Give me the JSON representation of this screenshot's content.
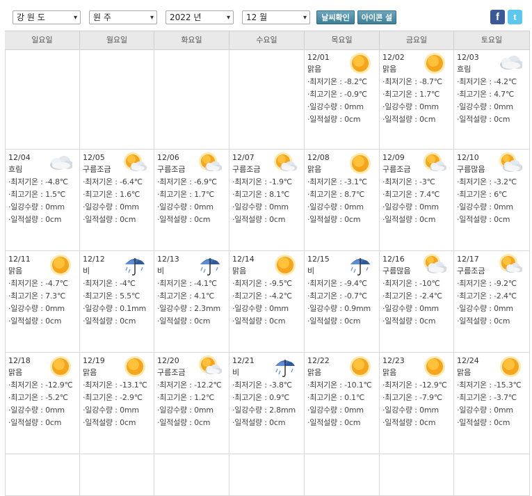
{
  "toolbar": {
    "province": "강 원 도",
    "city": "원 주",
    "year": "2022 년",
    "month": "12 월",
    "check_weather": "날씨확인",
    "icon_help": "아이콘 설명",
    "facebook": "f",
    "twitter": "t"
  },
  "weekdays": [
    "일요일",
    "월요일",
    "화요일",
    "수요일",
    "목요일",
    "금요일",
    "토요일"
  ],
  "labels": {
    "min": "·최저기온 : ",
    "max": "·최고기온 : ",
    "rain": "·일강수량 : ",
    "snow": "·일적설량 : "
  },
  "days": [
    {
      "date": "12/01",
      "cond": "맑음",
      "icon": "sun-icon",
      "min": "-8.2℃",
      "max": "-0.9℃",
      "rain": "0mm",
      "snow": "0cm"
    },
    {
      "date": "12/02",
      "cond": "맑음",
      "icon": "sun-icon",
      "min": "-8.7℃",
      "max": "1.7℃",
      "rain": "0mm",
      "snow": "0cm"
    },
    {
      "date": "12/03",
      "cond": "흐림",
      "icon": "cloud-icon",
      "min": "-4.2℃",
      "max": "4.7℃",
      "rain": "0mm",
      "snow": "0cm"
    },
    {
      "date": "12/04",
      "cond": "흐림",
      "icon": "cloud-icon",
      "min": "-4.8℃",
      "max": "1.5℃",
      "rain": "0mm",
      "snow": "0cm"
    },
    {
      "date": "12/05",
      "cond": "구름조금",
      "icon": "sun-cloud-icon",
      "min": "-6.4℃",
      "max": "1.6℃",
      "rain": "0mm",
      "snow": "0cm"
    },
    {
      "date": "12/06",
      "cond": "구름조금",
      "icon": "sun-cloud-icon",
      "min": "-6.9℃",
      "max": "1.7℃",
      "rain": "0mm",
      "snow": "0cm"
    },
    {
      "date": "12/07",
      "cond": "구름조금",
      "icon": "sun-cloud-icon",
      "min": "-1.9℃",
      "max": "8.1℃",
      "rain": "0mm",
      "snow": "0cm"
    },
    {
      "date": "12/08",
      "cond": "맑음",
      "icon": "sun-icon",
      "min": "-3.1℃",
      "max": "8.7℃",
      "rain": "0mm",
      "snow": "0cm"
    },
    {
      "date": "12/09",
      "cond": "구름조금",
      "icon": "sun-cloud-icon",
      "min": "-3℃",
      "max": "7.4℃",
      "rain": "0mm",
      "snow": "0cm"
    },
    {
      "date": "12/10",
      "cond": "구름많음",
      "icon": "cloud-sun-icon",
      "min": "-3.2℃",
      "max": "6℃",
      "rain": "0mm",
      "snow": "0cm"
    },
    {
      "date": "12/11",
      "cond": "맑음",
      "icon": "sun-icon",
      "min": "-4.7℃",
      "max": "7.3℃",
      "rain": "0mm",
      "snow": "0cm"
    },
    {
      "date": "12/12",
      "cond": "비",
      "icon": "umbrella-icon",
      "min": "-4℃",
      "max": "5.5℃",
      "rain": "0.1mm",
      "snow": "0cm"
    },
    {
      "date": "12/13",
      "cond": "비",
      "icon": "umbrella-icon",
      "min": "-4.1℃",
      "max": "4.1℃",
      "rain": "2.3mm",
      "snow": "0cm"
    },
    {
      "date": "12/14",
      "cond": "맑음",
      "icon": "sun-icon",
      "min": "-9.5℃",
      "max": "-4.2℃",
      "rain": "0mm",
      "snow": "0cm"
    },
    {
      "date": "12/15",
      "cond": "비",
      "icon": "umbrella-icon",
      "min": "-9.4℃",
      "max": "-0.7℃",
      "rain": "0.9mm",
      "snow": "0cm"
    },
    {
      "date": "12/16",
      "cond": "구름많음",
      "icon": "cloud-sun-icon",
      "min": "-10℃",
      "max": "-2.4℃",
      "rain": "0mm",
      "snow": "0cm"
    },
    {
      "date": "12/17",
      "cond": "구름조금",
      "icon": "sun-cloud-icon",
      "min": "-9.2℃",
      "max": "-2.4℃",
      "rain": "0mm",
      "snow": "0cm"
    },
    {
      "date": "12/18",
      "cond": "맑음",
      "icon": "sun-icon",
      "min": "-12.9℃",
      "max": "-5.2℃",
      "rain": "0mm",
      "snow": "0cm"
    },
    {
      "date": "12/19",
      "cond": "맑음",
      "icon": "sun-icon",
      "min": "-13.1℃",
      "max": "-2.9℃",
      "rain": "0mm",
      "snow": "0cm"
    },
    {
      "date": "12/20",
      "cond": "구름조금",
      "icon": "sun-cloud-icon",
      "min": "-12.2℃",
      "max": "1.2℃",
      "rain": "0mm",
      "snow": "0cm"
    },
    {
      "date": "12/21",
      "cond": "비",
      "icon": "umbrella-icon",
      "min": "-3.8℃",
      "max": "0.9℃",
      "rain": "2.8mm",
      "snow": "0cm"
    },
    {
      "date": "12/22",
      "cond": "맑음",
      "icon": "sun-icon",
      "min": "-10.1℃",
      "max": "0.1℃",
      "rain": "0mm",
      "snow": "0cm"
    },
    {
      "date": "12/23",
      "cond": "맑음",
      "icon": "sun-icon",
      "min": "-12.9℃",
      "max": "-7.9℃",
      "rain": "0mm",
      "snow": "0cm"
    },
    {
      "date": "12/24",
      "cond": "맑음",
      "icon": "sun-icon",
      "min": "-15.3℃",
      "max": "-3.7℃",
      "rain": "0mm",
      "snow": "0cm"
    }
  ]
}
